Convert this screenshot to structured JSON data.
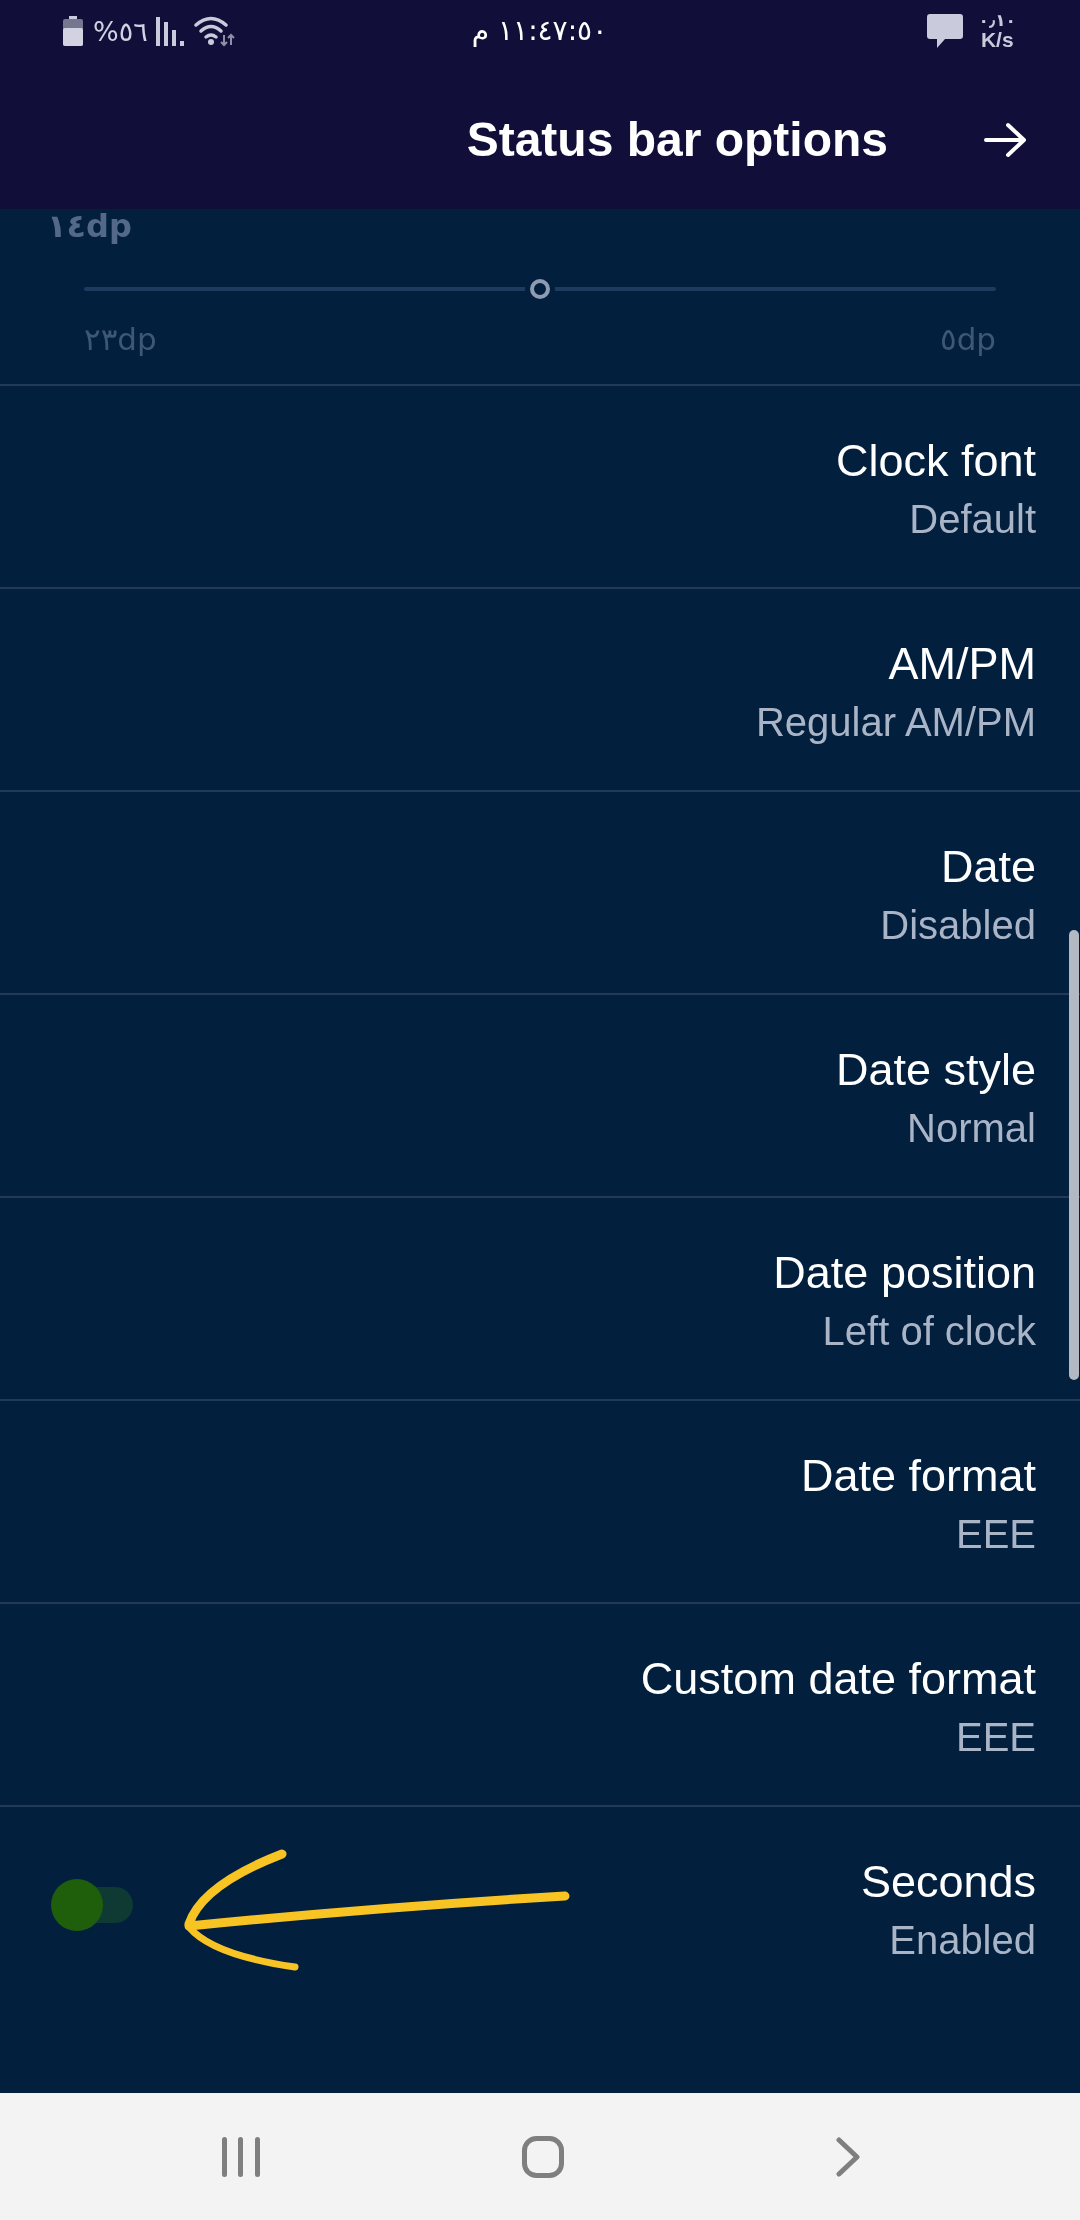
{
  "status_bar": {
    "battery": "٥٦%",
    "time": "١١:٤٧:٥٠ م",
    "speed_value": "٠٫١٠",
    "speed_unit": "K/s"
  },
  "toolbar": {
    "title": "Status bar options"
  },
  "slider": {
    "value_label": "١٤dp",
    "level": 0.5,
    "left_label": "٢٣dp",
    "right_label": "٥dp"
  },
  "rows": [
    {
      "kind": "text",
      "title": "Clock font",
      "summary": "Default"
    },
    {
      "kind": "text",
      "title": "AM/PM",
      "summary": "Regular AM/PM"
    },
    {
      "kind": "text",
      "title": "Date",
      "summary": "Disabled"
    },
    {
      "kind": "text",
      "title": "Date style",
      "summary": "Normal"
    },
    {
      "kind": "text",
      "title": "Date position",
      "summary": "Left of clock"
    },
    {
      "kind": "text",
      "title": "Date format",
      "summary": "EEE"
    },
    {
      "kind": "text",
      "title": "Custom date format",
      "summary": "EEE"
    },
    {
      "kind": "switch",
      "title": "Seconds",
      "summary": "Enabled",
      "on": true
    }
  ]
}
